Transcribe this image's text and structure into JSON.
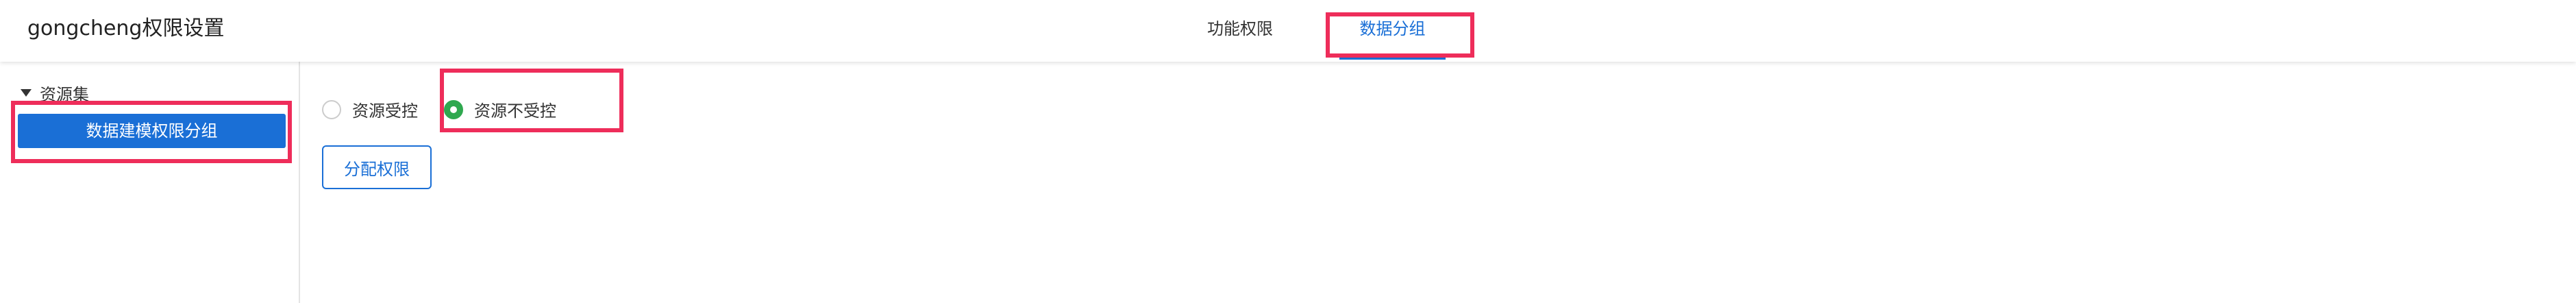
{
  "header": {
    "title": "gongcheng权限设置",
    "tabs": [
      {
        "label": "功能权限",
        "active": false
      },
      {
        "label": "数据分组",
        "active": true
      }
    ]
  },
  "sidebar": {
    "root": {
      "label": "资源集",
      "expanded": true
    },
    "nodes": [
      {
        "label": "数据建模权限分组",
        "selected": true
      }
    ]
  },
  "main": {
    "radios": [
      {
        "label": "资源受控",
        "checked": false
      },
      {
        "label": "资源不受控",
        "checked": true
      }
    ],
    "assign_button": "分配权限"
  },
  "colors": {
    "accent": "#1a6fd6",
    "radio_checked": "#2fa84f",
    "highlight": "#ee2d5a"
  }
}
